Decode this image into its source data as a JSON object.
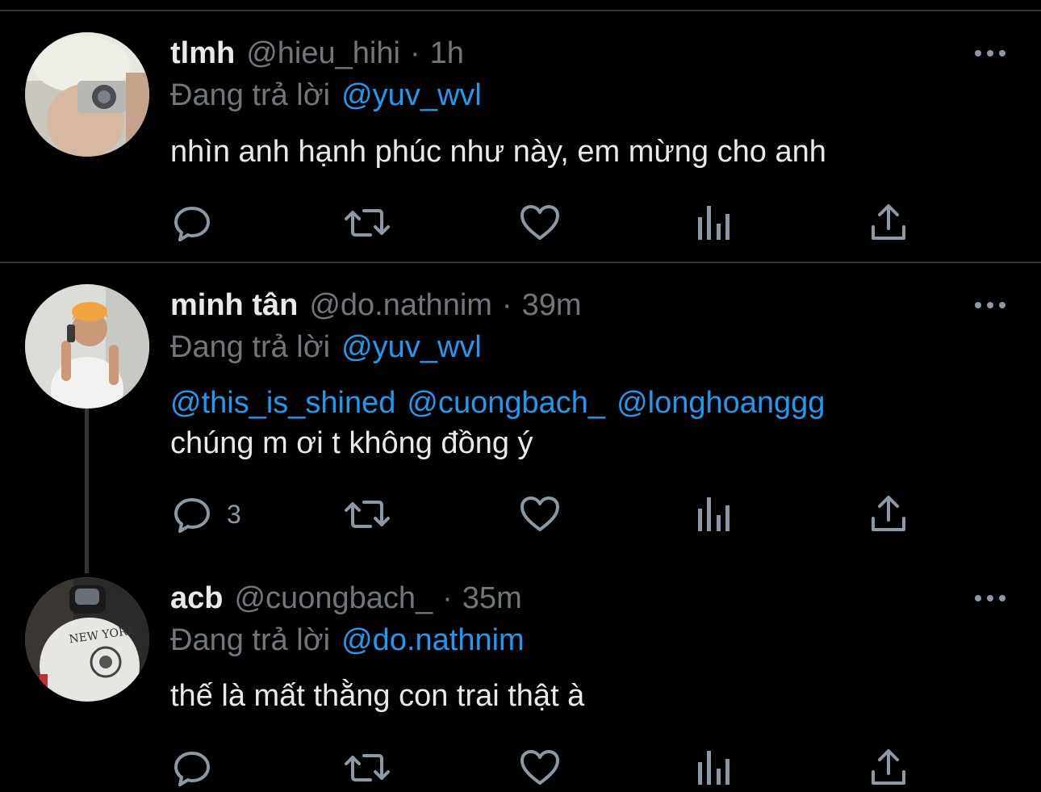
{
  "reply_prefix": "Đang trả lời",
  "tweets": [
    {
      "display_name": "tlmh",
      "handle": "@hieu_hihi",
      "separator": "·",
      "time": "1h",
      "replying_to": "@yuv_wvl",
      "text": "nhìn anh hạnh phúc như này, em mừng cho anh",
      "reply_count": "",
      "avatar_desc": "avatar-camera"
    },
    {
      "display_name": "minh tân",
      "handle": "@do.nathnim",
      "separator": "·",
      "time": "39m",
      "replying_to": "@yuv_wvl",
      "mentions": [
        "@this_is_shined",
        "@cuongbach_",
        "@longhoanggg"
      ],
      "text": "chúng m ơi t không đồng ý",
      "reply_count": "3",
      "avatar_desc": "avatar-mirror-selfie"
    },
    {
      "display_name": "acb",
      "handle": "@cuongbach_",
      "separator": "·",
      "time": "35m",
      "replying_to": "@do.nathnim",
      "text": "thế là mất thằng con trai thật à",
      "reply_count": "",
      "avatar_desc": "avatar-jacket"
    }
  ],
  "icons": {
    "reply": "speech-bubble-icon",
    "retweet": "retweet-icon",
    "like": "heart-icon",
    "views": "bar-chart-icon",
    "share": "share-upload-icon",
    "more": "more-dots-icon"
  },
  "colors": {
    "background": "#000000",
    "text": "#e7e9ea",
    "muted": "#71767b",
    "link": "#1d9bf0",
    "icon": "#8b98a5",
    "divider": "#2f3336"
  }
}
